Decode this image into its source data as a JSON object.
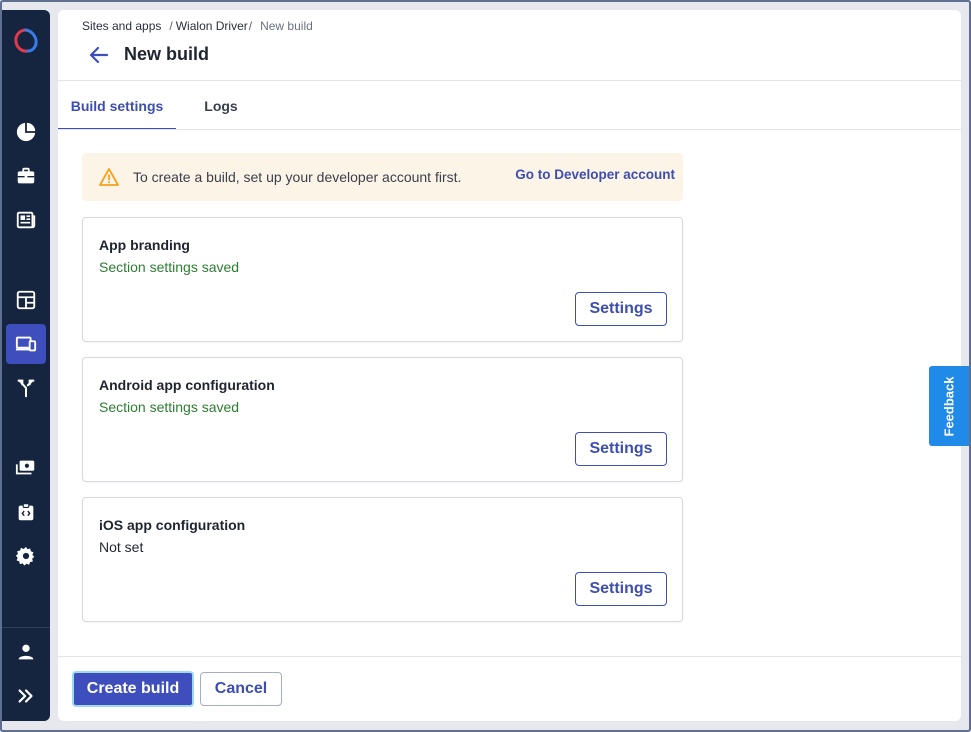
{
  "breadcrumb": {
    "items": [
      "Sites and apps",
      "Wialon Driver",
      "New build"
    ]
  },
  "header": {
    "title": "New build"
  },
  "tabs": [
    {
      "label": "Build settings",
      "active": true
    },
    {
      "label": "Logs",
      "active": false
    }
  ],
  "alert": {
    "text": "To create a build, set up your developer account first.",
    "link": "Go to Developer account"
  },
  "cards": [
    {
      "title": "App branding",
      "status": "Section settings saved",
      "button": "Settings"
    },
    {
      "title": "Android app configuration",
      "status": "Section settings saved",
      "button": "Settings"
    },
    {
      "title": "iOS app configuration",
      "status": "Not set",
      "button": "Settings"
    }
  ],
  "footer": {
    "create_label": "Create build",
    "cancel_label": "Cancel"
  },
  "feedback": {
    "label": "Feedback"
  },
  "sidebar": {
    "icons": [
      "pie-chart-icon",
      "briefcase-icon",
      "newspaper-icon",
      "dashboard-icon",
      "devices-icon",
      "merge-icon",
      "payments-icon",
      "code-clipboard-icon",
      "gear-icon",
      "user-icon",
      "expand-icon"
    ]
  },
  "colors": {
    "accent": "#3e4fbd",
    "sidebar": "#15253f",
    "saved": "#2e7d32",
    "warning_bg": "#fdf4e8",
    "warning_icon": "#f4a21d",
    "feedback": "#1f8ae8"
  }
}
